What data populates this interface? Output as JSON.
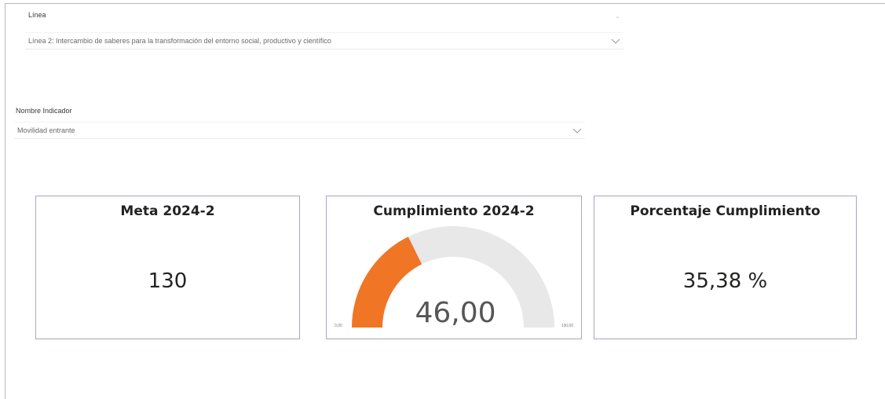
{
  "slicers": {
    "linea": {
      "label": "Línea",
      "value": "Línea 2: Intercambio de saberes para la transformación del entorno social, productivo y científico"
    },
    "indicador": {
      "label": "Nombre Indicador",
      "value": "Movilidad entrante"
    }
  },
  "cards": {
    "meta": {
      "title": "Meta 2024-2",
      "value": "130"
    },
    "cumplimiento": {
      "title": "Cumplimiento  2024-2",
      "value": "46,00",
      "min_label": "0,00",
      "max_label": "130,00",
      "gauge": {
        "min": 0,
        "max": 130,
        "current": 46
      },
      "colors": {
        "fill": "#f07525",
        "track": "#e8e8e8"
      }
    },
    "porcentaje": {
      "title": "Porcentaje Cumplimiento",
      "value": "35,38 %"
    }
  }
}
